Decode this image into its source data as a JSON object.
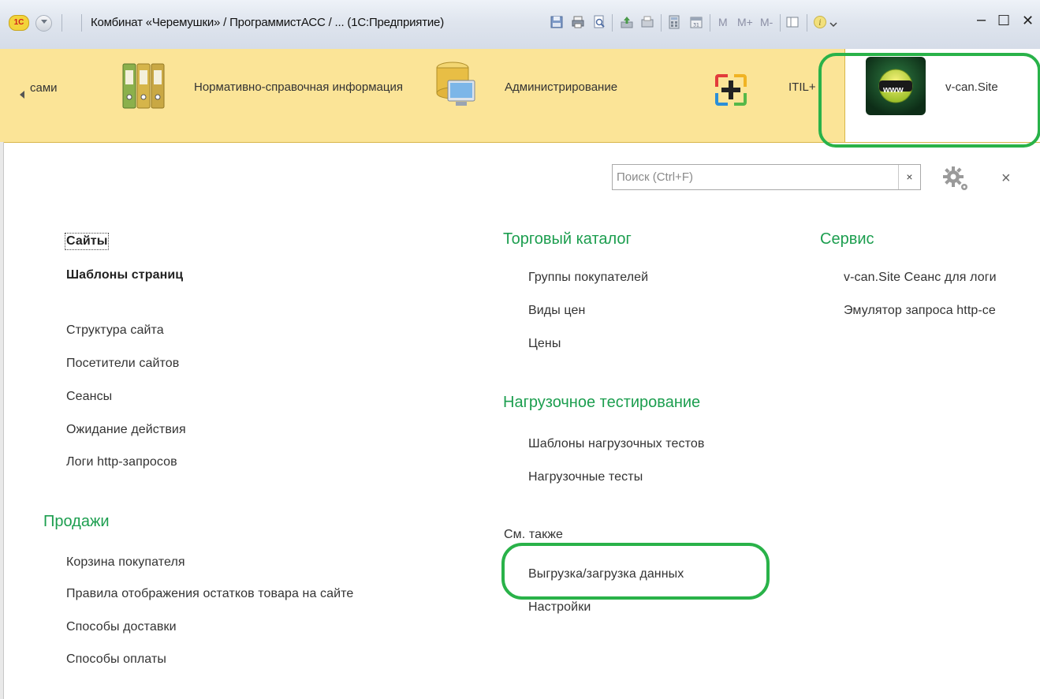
{
  "titlebar": {
    "logo_text": "1С",
    "title": "Комбинат «Черемушки» / ПрограммистАСС / ... (1С:Предприятие)",
    "m_labels": [
      "M",
      "M+",
      "M-"
    ],
    "minimize": "–",
    "maximize": "☐",
    "close": "✕"
  },
  "sections": [
    {
      "label": "сами",
      "icon": "none"
    },
    {
      "label": "Нормативно-справочная информация",
      "icon": "binders-icon"
    },
    {
      "label": "Администрирование",
      "icon": "database-computer-icon"
    },
    {
      "label": "ITIL+",
      "icon": "plus-icon"
    },
    {
      "label": "v-can.Site",
      "icon": "www-icon",
      "active": true
    }
  ],
  "www_badge": "www",
  "search": {
    "placeholder": "Поиск (Ctrl+F)",
    "value": "",
    "clear": "×"
  },
  "close_label": "×",
  "columns": {
    "left": {
      "top_items": [
        {
          "label": "Сайты",
          "bold": true
        },
        {
          "label": "Шаблоны страниц",
          "bold": true
        }
      ],
      "items": [
        "Структура сайта",
        "Посетители сайтов",
        "Сеансы",
        "Ожидание действия",
        "Логи http-запросов"
      ],
      "sales_title": "Продажи",
      "sales_items": [
        "Корзина покупателя",
        "Правила отображения остатков товара на сайте",
        "Способы доставки",
        "Способы оплаты"
      ]
    },
    "middle": {
      "catalog_title": "Торговый каталог",
      "catalog_items": [
        "Группы покупателей",
        "Виды цен",
        "Цены"
      ],
      "load_title": "Нагрузочное тестирование",
      "load_items": [
        "Шаблоны нагрузочных тестов",
        "Нагрузочные тесты"
      ],
      "see_also_title": "См. также",
      "see_also_items": [
        "Выгрузка/загрузка данных",
        "Настройки"
      ]
    },
    "right": {
      "service_title": "Сервис",
      "service_items": [
        "v-can.Site Сеанс для логи",
        "Эмулятор запроса http-се"
      ]
    }
  },
  "colors": {
    "panel": "#fbe497",
    "group_title": "#1c9e4f",
    "highlight": "#29b249"
  }
}
